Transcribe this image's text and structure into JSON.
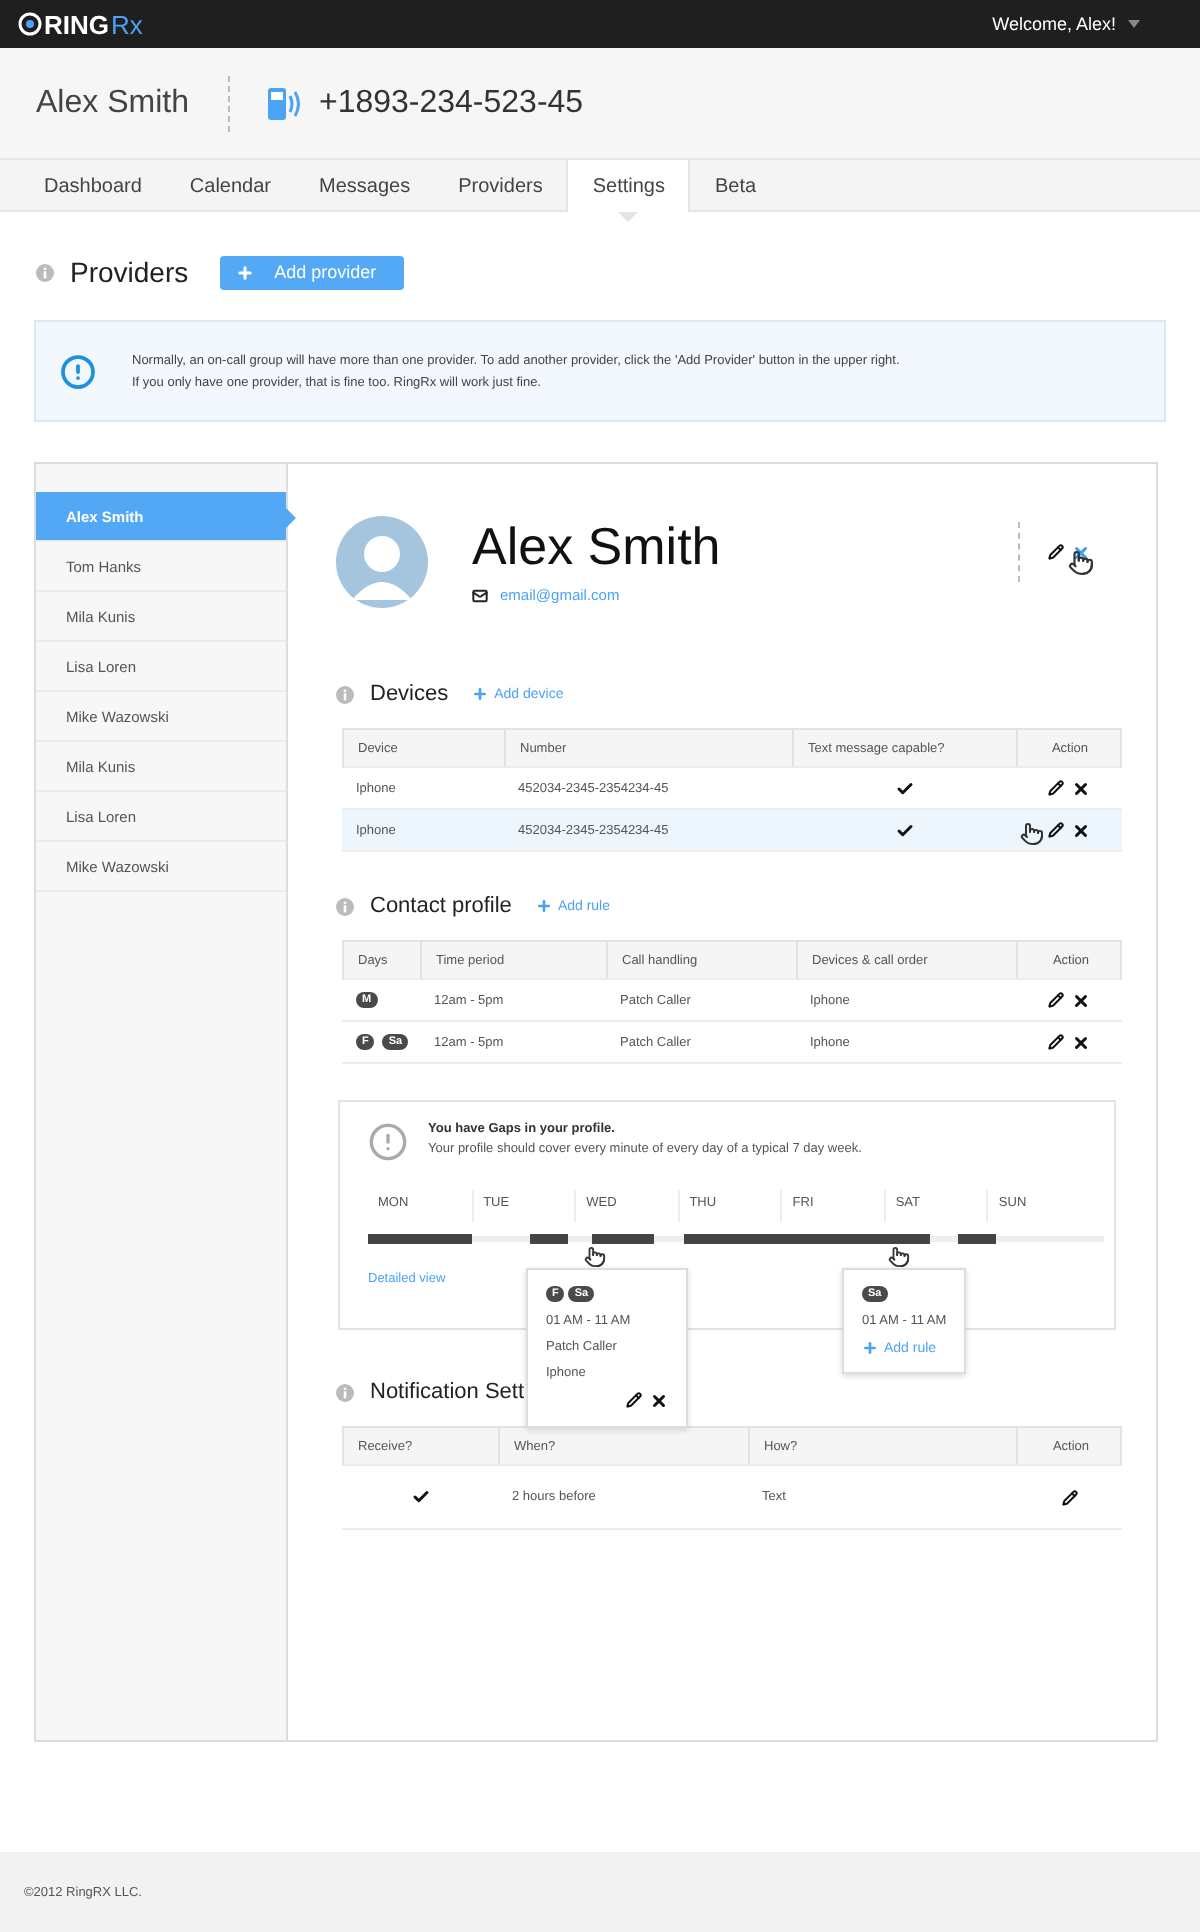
{
  "topbar": {
    "brand": "RING",
    "brand_suffix": "Rx",
    "welcome": "Welcome, Alex!"
  },
  "header": {
    "name": "Alex Smith",
    "phone": "+1893-234-523-45"
  },
  "tabs": [
    {
      "label": "Dashboard",
      "selected": false
    },
    {
      "label": "Calendar",
      "selected": false
    },
    {
      "label": "Messages",
      "selected": false
    },
    {
      "label": "Providers",
      "selected": false
    },
    {
      "label": "Settings",
      "selected": true
    },
    {
      "label": "Beta",
      "selected": false
    }
  ],
  "page_title": "Providers",
  "add_provider": "Add provider",
  "notice": [
    "Normally, an on-call group will have more than one provider. To add another provider, click the 'Add Provider' button in the upper right.",
    "If you only have one provider, that is fine too. RingRx will work just fine."
  ],
  "sidebar": {
    "items": [
      {
        "label": "Alex Smith",
        "selected": true
      },
      {
        "label": "Tom Hanks",
        "selected": false
      },
      {
        "label": "Mila Kunis",
        "selected": false
      },
      {
        "label": "Lisa Loren",
        "selected": false
      },
      {
        "label": "Mike Wazowski",
        "selected": false
      },
      {
        "label": "Mila Kunis",
        "selected": false
      },
      {
        "label": "Lisa Loren",
        "selected": false
      },
      {
        "label": "Mike Wazowski",
        "selected": false
      }
    ]
  },
  "profile": {
    "name": "Alex Smith",
    "email": "email@gmail.com"
  },
  "devices": {
    "title": "Devices",
    "add": "Add device",
    "columns": [
      "Device",
      "Number",
      "Text message capable?",
      "Action"
    ],
    "rows": [
      {
        "device": "Iphone",
        "number": "452034-2345-2354234-45",
        "text_capable": true,
        "selected": false
      },
      {
        "device": "Iphone",
        "number": "452034-2345-2354234-45",
        "text_capable": true,
        "selected": true
      }
    ]
  },
  "contact_profile": {
    "title": "Contact profile",
    "add": "Add rule",
    "columns": [
      "Days",
      "Time period",
      "Call handling",
      "Devices & call order",
      "Action"
    ],
    "rows": [
      {
        "days": [
          "M"
        ],
        "time": "12am - 5pm",
        "handling": "Patch Caller",
        "devices": "Iphone"
      },
      {
        "days": [
          "F",
          "Sa"
        ],
        "time": "12am - 5pm",
        "handling": "Patch Caller",
        "devices": "Iphone"
      }
    ]
  },
  "gaps": {
    "title": "You have Gaps in your profile.",
    "subtitle": "Your profile should cover every minute of every day of a typical 7 day week.",
    "days": [
      "MON",
      "TUE",
      "WED",
      "THU",
      "FRI",
      "SAT",
      "SUN"
    ],
    "link": "Detailed view",
    "popovers": [
      {
        "kind": "rule",
        "days": [
          "F",
          "Sa"
        ],
        "time": "01 AM - 11 AM",
        "handling": "Patch Caller",
        "devices": "Iphone"
      },
      {
        "kind": "gap",
        "days": [
          "Sa"
        ],
        "time": "01 AM - 11 AM",
        "add": "Add rule"
      }
    ]
  },
  "notifications": {
    "title": "Notification Sett",
    "columns": [
      "Receive?",
      "When?",
      "How?",
      "Action"
    ],
    "rows": [
      {
        "receive": true,
        "when": "2 hours before",
        "how": "Text"
      }
    ]
  },
  "footer": "©2012 RingRX LLC."
}
